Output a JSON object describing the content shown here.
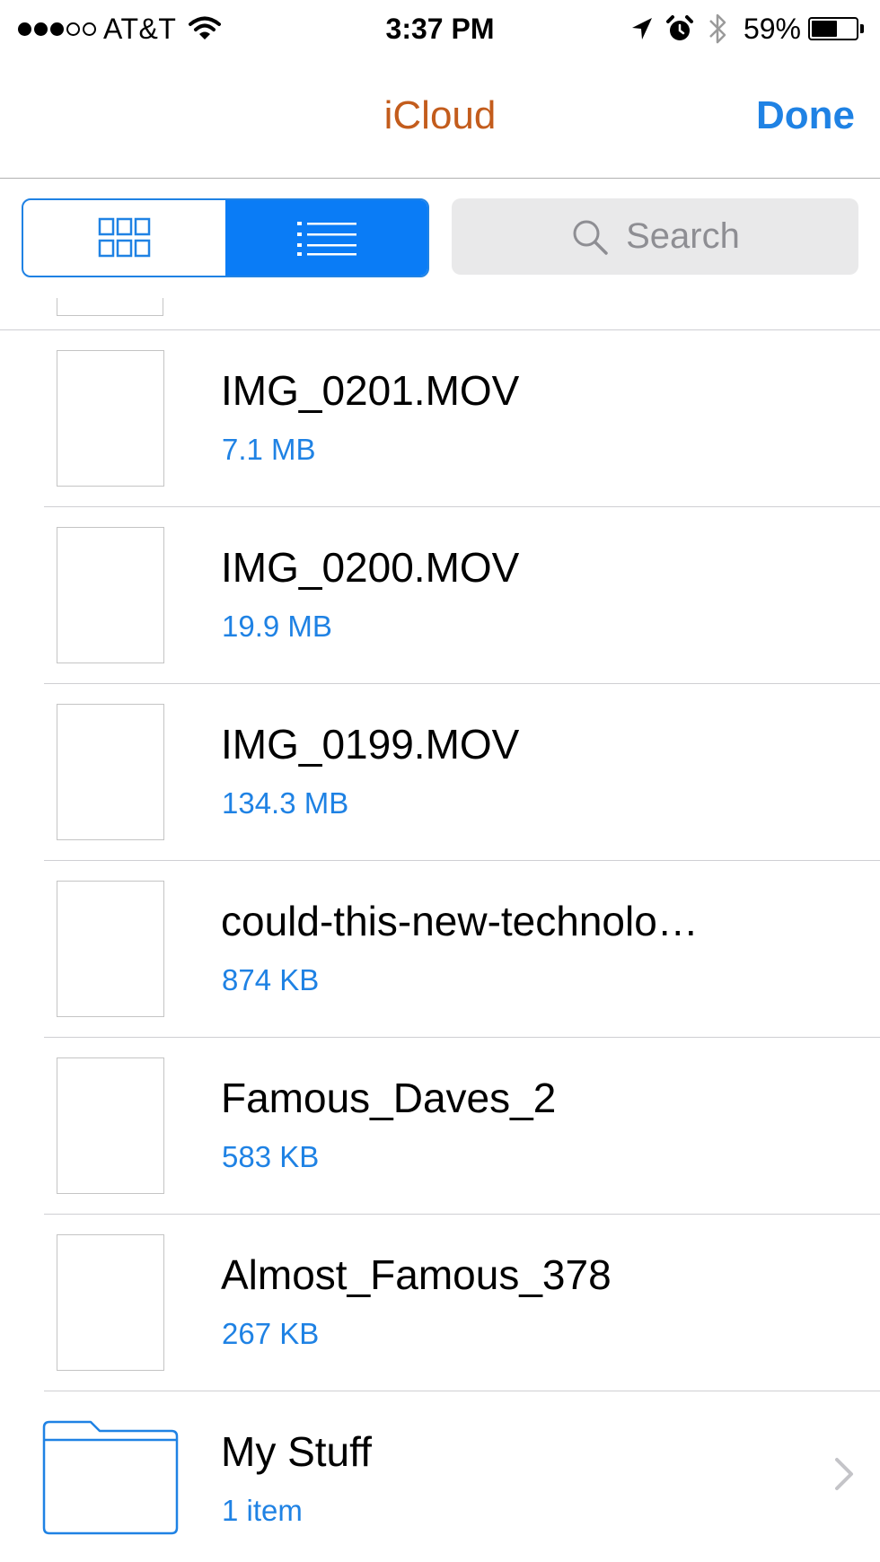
{
  "status_bar": {
    "carrier": "AT&T",
    "signal_bars_filled": 3,
    "signal_bars_total": 5,
    "time": "3:37 PM",
    "battery_percent": "59%",
    "battery_level": 0.59
  },
  "nav": {
    "title": "iCloud",
    "done_label": "Done"
  },
  "toolbar": {
    "view_modes": [
      "grid",
      "list"
    ],
    "active_view": "list",
    "search_placeholder": "Search"
  },
  "files": [
    {
      "name": "IMG_0201.MOV",
      "size": "7.1 MB"
    },
    {
      "name": "IMG_0200.MOV",
      "size": "19.9 MB"
    },
    {
      "name": "IMG_0199.MOV",
      "size": "134.3 MB"
    },
    {
      "name": "could-this-new-technolo…",
      "size": "874 KB"
    },
    {
      "name": "Famous_Daves_2",
      "size": "583 KB"
    },
    {
      "name": "Almost_Famous_378",
      "size": "267 KB"
    }
  ],
  "folder": {
    "name": "My Stuff",
    "count": "1 item"
  },
  "colors": {
    "accent": "#1f82e4",
    "title": "#c35c1c",
    "segment_active": "#0a7cf6"
  }
}
